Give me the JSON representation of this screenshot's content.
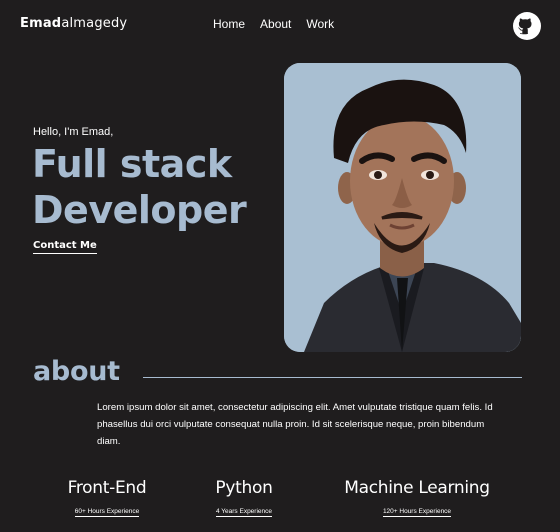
{
  "header": {
    "brand_bold": "Emad",
    "brand_rest": "almagedy",
    "nav": [
      "Home",
      "About",
      "Work"
    ],
    "github_icon": "github-icon"
  },
  "hero": {
    "greeting": "Hello, I'm Emad,",
    "title_line1": "Full stack",
    "title_line2": "Developer",
    "cta": "Contact Me",
    "portrait": "portrait-illustration"
  },
  "about": {
    "title": "about",
    "text": "Lorem ipsum dolor sit amet, consectetur adipiscing elit. Amet vulputate tristique quam felis. Id phasellus dui orci vulputate consequat nulla proin. Id sit scelerisque neque, proin bibendum diam."
  },
  "skills": [
    {
      "name": "Front-End",
      "experience": "60+ Hours Experience"
    },
    {
      "name": "Python",
      "experience": "4 Years Experience"
    },
    {
      "name": "Machine Learning",
      "experience": "120+ Hours Experience"
    }
  ],
  "colors": {
    "background": "#1f1d1e",
    "accent": "#a7bbd0",
    "text": "#ffffff"
  }
}
